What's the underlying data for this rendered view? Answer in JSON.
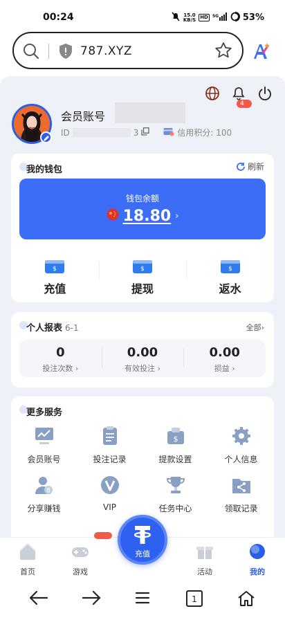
{
  "status": {
    "time": "00:24",
    "net_speed": "15.0",
    "net_unit": "KB/S",
    "hd": "HD",
    "signal": "⁵ᴳ",
    "battery": "53%"
  },
  "browser": {
    "url": "787.XYZ"
  },
  "header": {
    "notification_count": "4"
  },
  "profile": {
    "account_label": "会员账号",
    "id_prefix": "ID",
    "id_suffix": "3",
    "credit": "信用积分: 100"
  },
  "wallet": {
    "title": "我的钱包",
    "refresh": "刷新",
    "balance_label": "钱包余额",
    "balance": "18.80",
    "balance_chevron": "›",
    "actions": [
      "充值",
      "提现",
      "返水"
    ]
  },
  "report": {
    "title": "个人报表",
    "period": "6-1",
    "all": "全部›",
    "stats": [
      {
        "value": "0",
        "label": "投注次数 ›"
      },
      {
        "value": "0.00",
        "label": "有效投注 ›"
      },
      {
        "value": "0.00",
        "label": "损益 ›"
      }
    ]
  },
  "services": {
    "title": "更多服务",
    "items": [
      {
        "label": "会员账号",
        "icon": "chart-monitor-icon"
      },
      {
        "label": "投注记录",
        "icon": "clipboard-icon"
      },
      {
        "label": "提款设置",
        "icon": "money-bag-icon"
      },
      {
        "label": "个人信息",
        "icon": "gear-icon"
      },
      {
        "label": "分享赚钱",
        "icon": "share-user-icon"
      },
      {
        "label": "VIP",
        "icon": "vip-icon"
      },
      {
        "label": "任务中心",
        "icon": "trophy-icon"
      },
      {
        "label": "领取记录",
        "icon": "share-folder-icon"
      }
    ]
  },
  "tabbar": {
    "items": [
      "首页",
      "游戏",
      "活动",
      "我的"
    ],
    "center": "充值"
  },
  "colors": {
    "primary": "#3b6df6",
    "accent_blue": "#2b5ee8",
    "badge_red": "#f15a4a",
    "page_bg": "#eef2f8"
  }
}
